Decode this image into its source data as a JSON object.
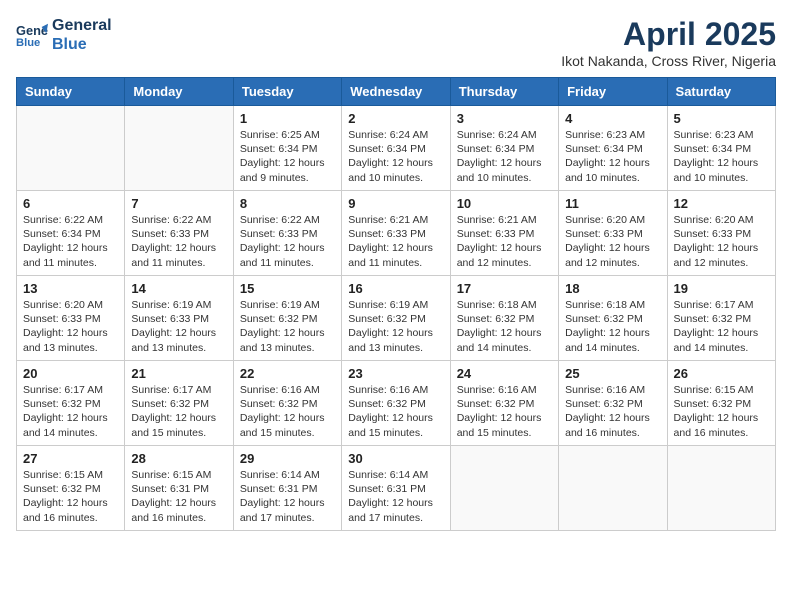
{
  "header": {
    "logo_line1": "General",
    "logo_line2": "Blue",
    "month": "April 2025",
    "location": "Ikot Nakanda, Cross River, Nigeria"
  },
  "weekdays": [
    "Sunday",
    "Monday",
    "Tuesday",
    "Wednesday",
    "Thursday",
    "Friday",
    "Saturday"
  ],
  "weeks": [
    [
      {
        "day": "",
        "detail": ""
      },
      {
        "day": "",
        "detail": ""
      },
      {
        "day": "1",
        "detail": "Sunrise: 6:25 AM\nSunset: 6:34 PM\nDaylight: 12 hours\nand 9 minutes."
      },
      {
        "day": "2",
        "detail": "Sunrise: 6:24 AM\nSunset: 6:34 PM\nDaylight: 12 hours\nand 10 minutes."
      },
      {
        "day": "3",
        "detail": "Sunrise: 6:24 AM\nSunset: 6:34 PM\nDaylight: 12 hours\nand 10 minutes."
      },
      {
        "day": "4",
        "detail": "Sunrise: 6:23 AM\nSunset: 6:34 PM\nDaylight: 12 hours\nand 10 minutes."
      },
      {
        "day": "5",
        "detail": "Sunrise: 6:23 AM\nSunset: 6:34 PM\nDaylight: 12 hours\nand 10 minutes."
      }
    ],
    [
      {
        "day": "6",
        "detail": "Sunrise: 6:22 AM\nSunset: 6:34 PM\nDaylight: 12 hours\nand 11 minutes."
      },
      {
        "day": "7",
        "detail": "Sunrise: 6:22 AM\nSunset: 6:33 PM\nDaylight: 12 hours\nand 11 minutes."
      },
      {
        "day": "8",
        "detail": "Sunrise: 6:22 AM\nSunset: 6:33 PM\nDaylight: 12 hours\nand 11 minutes."
      },
      {
        "day": "9",
        "detail": "Sunrise: 6:21 AM\nSunset: 6:33 PM\nDaylight: 12 hours\nand 11 minutes."
      },
      {
        "day": "10",
        "detail": "Sunrise: 6:21 AM\nSunset: 6:33 PM\nDaylight: 12 hours\nand 12 minutes."
      },
      {
        "day": "11",
        "detail": "Sunrise: 6:20 AM\nSunset: 6:33 PM\nDaylight: 12 hours\nand 12 minutes."
      },
      {
        "day": "12",
        "detail": "Sunrise: 6:20 AM\nSunset: 6:33 PM\nDaylight: 12 hours\nand 12 minutes."
      }
    ],
    [
      {
        "day": "13",
        "detail": "Sunrise: 6:20 AM\nSunset: 6:33 PM\nDaylight: 12 hours\nand 13 minutes."
      },
      {
        "day": "14",
        "detail": "Sunrise: 6:19 AM\nSunset: 6:33 PM\nDaylight: 12 hours\nand 13 minutes."
      },
      {
        "day": "15",
        "detail": "Sunrise: 6:19 AM\nSunset: 6:32 PM\nDaylight: 12 hours\nand 13 minutes."
      },
      {
        "day": "16",
        "detail": "Sunrise: 6:19 AM\nSunset: 6:32 PM\nDaylight: 12 hours\nand 13 minutes."
      },
      {
        "day": "17",
        "detail": "Sunrise: 6:18 AM\nSunset: 6:32 PM\nDaylight: 12 hours\nand 14 minutes."
      },
      {
        "day": "18",
        "detail": "Sunrise: 6:18 AM\nSunset: 6:32 PM\nDaylight: 12 hours\nand 14 minutes."
      },
      {
        "day": "19",
        "detail": "Sunrise: 6:17 AM\nSunset: 6:32 PM\nDaylight: 12 hours\nand 14 minutes."
      }
    ],
    [
      {
        "day": "20",
        "detail": "Sunrise: 6:17 AM\nSunset: 6:32 PM\nDaylight: 12 hours\nand 14 minutes."
      },
      {
        "day": "21",
        "detail": "Sunrise: 6:17 AM\nSunset: 6:32 PM\nDaylight: 12 hours\nand 15 minutes."
      },
      {
        "day": "22",
        "detail": "Sunrise: 6:16 AM\nSunset: 6:32 PM\nDaylight: 12 hours\nand 15 minutes."
      },
      {
        "day": "23",
        "detail": "Sunrise: 6:16 AM\nSunset: 6:32 PM\nDaylight: 12 hours\nand 15 minutes."
      },
      {
        "day": "24",
        "detail": "Sunrise: 6:16 AM\nSunset: 6:32 PM\nDaylight: 12 hours\nand 15 minutes."
      },
      {
        "day": "25",
        "detail": "Sunrise: 6:16 AM\nSunset: 6:32 PM\nDaylight: 12 hours\nand 16 minutes."
      },
      {
        "day": "26",
        "detail": "Sunrise: 6:15 AM\nSunset: 6:32 PM\nDaylight: 12 hours\nand 16 minutes."
      }
    ],
    [
      {
        "day": "27",
        "detail": "Sunrise: 6:15 AM\nSunset: 6:32 PM\nDaylight: 12 hours\nand 16 minutes."
      },
      {
        "day": "28",
        "detail": "Sunrise: 6:15 AM\nSunset: 6:31 PM\nDaylight: 12 hours\nand 16 minutes."
      },
      {
        "day": "29",
        "detail": "Sunrise: 6:14 AM\nSunset: 6:31 PM\nDaylight: 12 hours\nand 17 minutes."
      },
      {
        "day": "30",
        "detail": "Sunrise: 6:14 AM\nSunset: 6:31 PM\nDaylight: 12 hours\nand 17 minutes."
      },
      {
        "day": "",
        "detail": ""
      },
      {
        "day": "",
        "detail": ""
      },
      {
        "day": "",
        "detail": ""
      }
    ]
  ]
}
